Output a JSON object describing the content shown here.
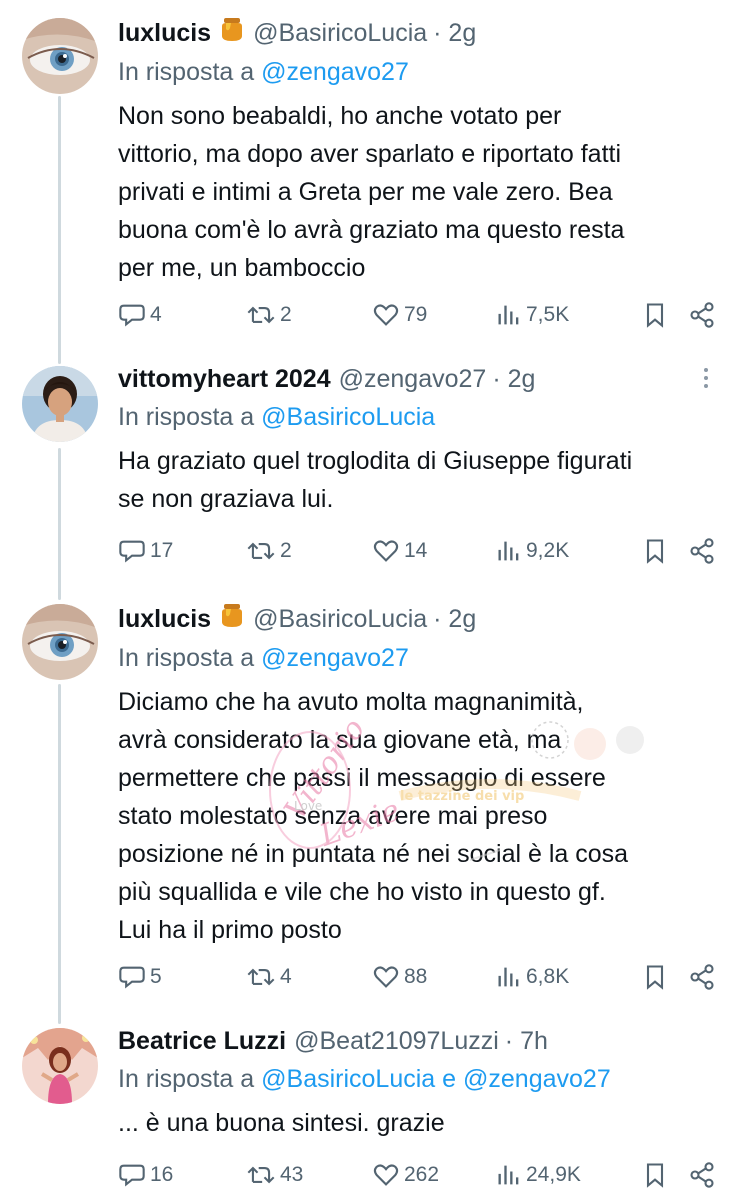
{
  "tweets": [
    {
      "name": "luxlucis",
      "handle": "@BasiricoLucia",
      "time": "· 2g",
      "reply_prefix": "In risposta a",
      "reply_mentions": [
        "@zengavo27"
      ],
      "reply_joiner": "",
      "text": "Non sono beabaldi, ho anche votato per\nvittorio, ma dopo aver sparlato e riportato fatti\nprivati e intimi a Greta per me vale zero. Bea\nbuona com'è lo avrà graziato ma questo resta\nper me, un bamboccio",
      "replies": "4",
      "reposts": "2",
      "likes": "79",
      "views": "7,5K"
    },
    {
      "name": "vittomyheart 2024",
      "handle": "@zengavo27",
      "time": "· 2g",
      "reply_prefix": "In risposta a",
      "reply_mentions": [
        "@BasiricoLucia"
      ],
      "reply_joiner": "",
      "text": "Ha graziato quel troglodita di Giuseppe figurati\nse non graziava lui.",
      "replies": "17",
      "reposts": "2",
      "likes": "14",
      "views": "9,2K"
    },
    {
      "name": "luxlucis",
      "handle": "@BasiricoLucia",
      "time": "· 2g",
      "reply_prefix": "In risposta a",
      "reply_mentions": [
        "@zengavo27"
      ],
      "reply_joiner": "",
      "text": "Diciamo che ha avuto molta magnanimità,\navrà considerato la sua giovane età, ma\npermettere che passi il messaggio di essere\nstato molestato senza avere mai preso\nposizione né in puntata né nei social è la cosa\npiù squallida e vile che ho visto in questo gf.\nLui ha il primo posto",
      "replies": "5",
      "reposts": "4",
      "likes": "88",
      "views": "6,8K"
    },
    {
      "name": "Beatrice Luzzi",
      "handle": "@Beat21097Luzzi",
      "time": "· 7h",
      "reply_prefix": "In risposta a",
      "reply_mentions": [
        "@BasiricoLucia",
        "@zengavo27"
      ],
      "reply_joiner": "e",
      "text": "... è una buona sintesi. grazie",
      "replies": "16",
      "reposts": "43",
      "likes": "262",
      "views": "24,9K"
    }
  ],
  "watermark": {
    "line1": "Vittorio",
    "line2": "Love",
    "line3": "Lexie",
    "banner": "le tazzine dei vip"
  },
  "icons": {
    "badge": "honey-pot-emoji",
    "reply": "speech-bubble-icon",
    "repost": "repost-arrows-icon",
    "like": "heart-icon",
    "views": "bar-chart-icon",
    "bookmark": "bookmark-icon",
    "share": "share-icon",
    "more": "more-vertical-icon"
  },
  "colors": {
    "text": "#0f1419",
    "secondary": "#536471",
    "link": "#1d9bf0",
    "thread_line": "#cfd9de"
  }
}
